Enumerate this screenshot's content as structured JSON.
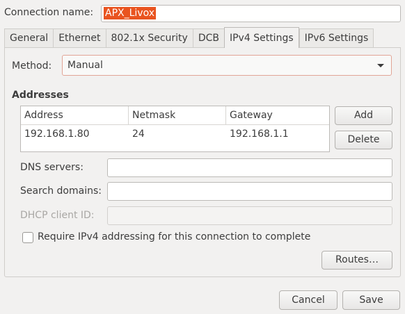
{
  "connection": {
    "name_label": "Connection name:",
    "name_value": "APX_Livox"
  },
  "tabs": [
    {
      "label": "General",
      "active": false
    },
    {
      "label": "Ethernet",
      "active": false
    },
    {
      "label": "802.1x Security",
      "active": false
    },
    {
      "label": "DCB",
      "active": false
    },
    {
      "label": "IPv4 Settings",
      "active": true
    },
    {
      "label": "IPv6 Settings",
      "active": false
    }
  ],
  "ipv4": {
    "method_label": "Method:",
    "method_value": "Manual",
    "addresses_title": "Addresses",
    "table": {
      "headers": [
        "Address",
        "Netmask",
        "Gateway"
      ],
      "rows": [
        [
          "192.168.1.80",
          "24",
          "192.168.1.1"
        ]
      ]
    },
    "add_label": "Add",
    "delete_label": "Delete",
    "dns_label": "DNS servers:",
    "dns_value": "",
    "search_label": "Search domains:",
    "search_value": "",
    "dhcp_label": "DHCP client ID:",
    "dhcp_value": "",
    "require_label": "Require IPv4 addressing for this connection to complete",
    "require_checked": false,
    "routes_label": "Routes…"
  },
  "footer": {
    "cancel_label": "Cancel",
    "save_label": "Save"
  },
  "colors": {
    "selection": "#e95420",
    "window_bg": "#f2f1f0",
    "focus_border": "#e1a596"
  }
}
